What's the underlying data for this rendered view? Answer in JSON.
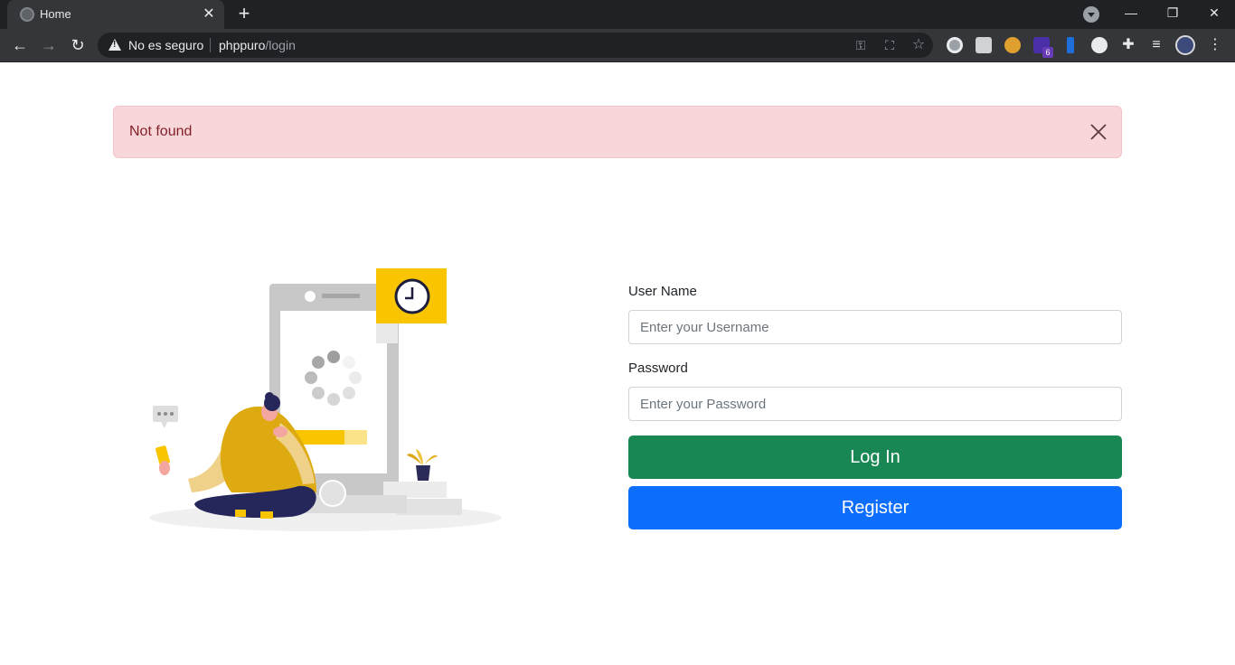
{
  "browser": {
    "tab_title": "Home",
    "security_text": "No es seguro",
    "url_host": "phppuro",
    "url_path": "/login",
    "extension_badge": "6",
    "colors": {
      "frame": "#202124",
      "toolbar": "#35363a"
    }
  },
  "alert": {
    "message": "Not found",
    "color": "#f8d7da"
  },
  "form": {
    "username_label": "User Name",
    "username_placeholder": "Enter your Username",
    "username_value": "",
    "password_label": "Password",
    "password_placeholder": "Enter your Password",
    "password_value": "",
    "login_label": "Log In",
    "register_label": "Register",
    "login_color": "#198754",
    "register_color": "#0d6efd"
  }
}
